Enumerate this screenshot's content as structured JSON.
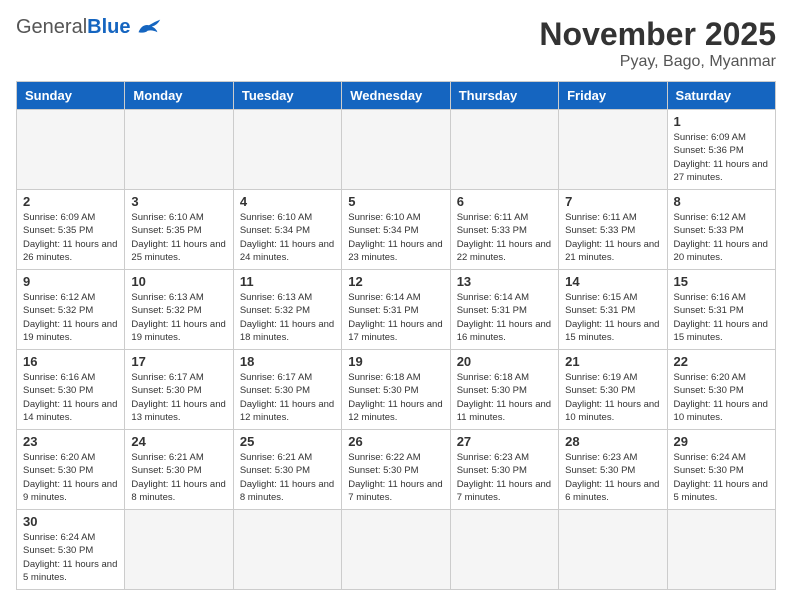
{
  "header": {
    "logo_general": "General",
    "logo_blue": "Blue",
    "month_title": "November 2025",
    "subtitle": "Pyay, Bago, Myanmar"
  },
  "days_of_week": [
    "Sunday",
    "Monday",
    "Tuesday",
    "Wednesday",
    "Thursday",
    "Friday",
    "Saturday"
  ],
  "weeks": [
    {
      "days": [
        {
          "num": "",
          "info": ""
        },
        {
          "num": "",
          "info": ""
        },
        {
          "num": "",
          "info": ""
        },
        {
          "num": "",
          "info": ""
        },
        {
          "num": "",
          "info": ""
        },
        {
          "num": "",
          "info": ""
        },
        {
          "num": "1",
          "info": "Sunrise: 6:09 AM\nSunset: 5:36 PM\nDaylight: 11 hours\nand 27 minutes."
        }
      ]
    },
    {
      "days": [
        {
          "num": "2",
          "info": "Sunrise: 6:09 AM\nSunset: 5:35 PM\nDaylight: 11 hours\nand 26 minutes."
        },
        {
          "num": "3",
          "info": "Sunrise: 6:10 AM\nSunset: 5:35 PM\nDaylight: 11 hours\nand 25 minutes."
        },
        {
          "num": "4",
          "info": "Sunrise: 6:10 AM\nSunset: 5:34 PM\nDaylight: 11 hours\nand 24 minutes."
        },
        {
          "num": "5",
          "info": "Sunrise: 6:10 AM\nSunset: 5:34 PM\nDaylight: 11 hours\nand 23 minutes."
        },
        {
          "num": "6",
          "info": "Sunrise: 6:11 AM\nSunset: 5:33 PM\nDaylight: 11 hours\nand 22 minutes."
        },
        {
          "num": "7",
          "info": "Sunrise: 6:11 AM\nSunset: 5:33 PM\nDaylight: 11 hours\nand 21 minutes."
        },
        {
          "num": "8",
          "info": "Sunrise: 6:12 AM\nSunset: 5:33 PM\nDaylight: 11 hours\nand 20 minutes."
        }
      ]
    },
    {
      "days": [
        {
          "num": "9",
          "info": "Sunrise: 6:12 AM\nSunset: 5:32 PM\nDaylight: 11 hours\nand 19 minutes."
        },
        {
          "num": "10",
          "info": "Sunrise: 6:13 AM\nSunset: 5:32 PM\nDaylight: 11 hours\nand 19 minutes."
        },
        {
          "num": "11",
          "info": "Sunrise: 6:13 AM\nSunset: 5:32 PM\nDaylight: 11 hours\nand 18 minutes."
        },
        {
          "num": "12",
          "info": "Sunrise: 6:14 AM\nSunset: 5:31 PM\nDaylight: 11 hours\nand 17 minutes."
        },
        {
          "num": "13",
          "info": "Sunrise: 6:14 AM\nSunset: 5:31 PM\nDaylight: 11 hours\nand 16 minutes."
        },
        {
          "num": "14",
          "info": "Sunrise: 6:15 AM\nSunset: 5:31 PM\nDaylight: 11 hours\nand 15 minutes."
        },
        {
          "num": "15",
          "info": "Sunrise: 6:16 AM\nSunset: 5:31 PM\nDaylight: 11 hours\nand 15 minutes."
        }
      ]
    },
    {
      "days": [
        {
          "num": "16",
          "info": "Sunrise: 6:16 AM\nSunset: 5:30 PM\nDaylight: 11 hours\nand 14 minutes."
        },
        {
          "num": "17",
          "info": "Sunrise: 6:17 AM\nSunset: 5:30 PM\nDaylight: 11 hours\nand 13 minutes."
        },
        {
          "num": "18",
          "info": "Sunrise: 6:17 AM\nSunset: 5:30 PM\nDaylight: 11 hours\nand 12 minutes."
        },
        {
          "num": "19",
          "info": "Sunrise: 6:18 AM\nSunset: 5:30 PM\nDaylight: 11 hours\nand 12 minutes."
        },
        {
          "num": "20",
          "info": "Sunrise: 6:18 AM\nSunset: 5:30 PM\nDaylight: 11 hours\nand 11 minutes."
        },
        {
          "num": "21",
          "info": "Sunrise: 6:19 AM\nSunset: 5:30 PM\nDaylight: 11 hours\nand 10 minutes."
        },
        {
          "num": "22",
          "info": "Sunrise: 6:20 AM\nSunset: 5:30 PM\nDaylight: 11 hours\nand 10 minutes."
        }
      ]
    },
    {
      "days": [
        {
          "num": "23",
          "info": "Sunrise: 6:20 AM\nSunset: 5:30 PM\nDaylight: 11 hours\nand 9 minutes."
        },
        {
          "num": "24",
          "info": "Sunrise: 6:21 AM\nSunset: 5:30 PM\nDaylight: 11 hours\nand 8 minutes."
        },
        {
          "num": "25",
          "info": "Sunrise: 6:21 AM\nSunset: 5:30 PM\nDaylight: 11 hours\nand 8 minutes."
        },
        {
          "num": "26",
          "info": "Sunrise: 6:22 AM\nSunset: 5:30 PM\nDaylight: 11 hours\nand 7 minutes."
        },
        {
          "num": "27",
          "info": "Sunrise: 6:23 AM\nSunset: 5:30 PM\nDaylight: 11 hours\nand 7 minutes."
        },
        {
          "num": "28",
          "info": "Sunrise: 6:23 AM\nSunset: 5:30 PM\nDaylight: 11 hours\nand 6 minutes."
        },
        {
          "num": "29",
          "info": "Sunrise: 6:24 AM\nSunset: 5:30 PM\nDaylight: 11 hours\nand 5 minutes."
        }
      ]
    },
    {
      "days": [
        {
          "num": "30",
          "info": "Sunrise: 6:24 AM\nSunset: 5:30 PM\nDaylight: 11 hours\nand 5 minutes."
        },
        {
          "num": "",
          "info": ""
        },
        {
          "num": "",
          "info": ""
        },
        {
          "num": "",
          "info": ""
        },
        {
          "num": "",
          "info": ""
        },
        {
          "num": "",
          "info": ""
        },
        {
          "num": "",
          "info": ""
        }
      ]
    }
  ]
}
